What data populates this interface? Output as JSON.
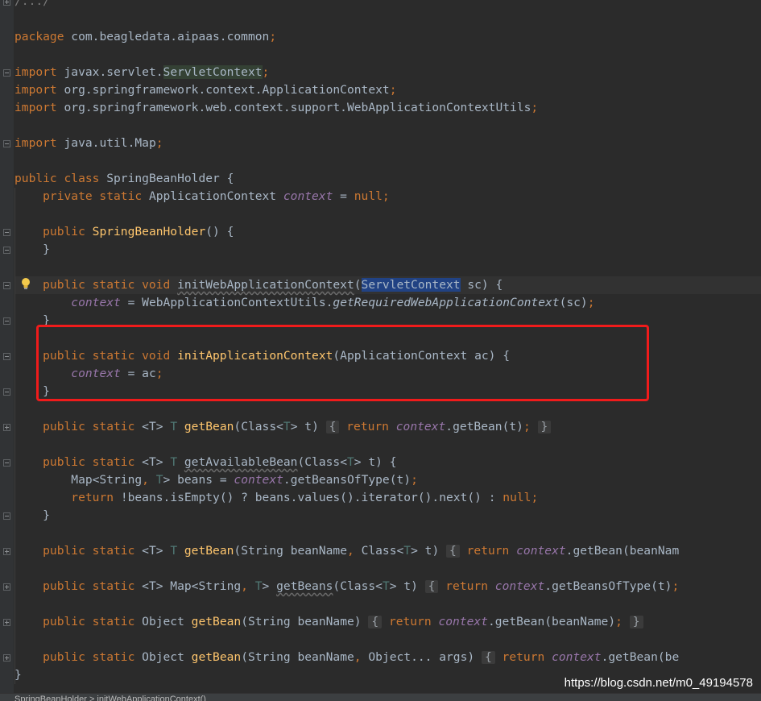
{
  "editor": {
    "lines": [
      {
        "id": "header-comment",
        "fold": "plus",
        "tokens": [
          [
            "/.../",
            "dim"
          ]
        ]
      },
      {
        "id": "blank-1",
        "tokens": []
      },
      {
        "id": "package",
        "tokens": [
          [
            "package ",
            "k"
          ],
          [
            "com.beagledata.aipaas.common",
            ""
          ],
          [
            ";",
            "k"
          ]
        ]
      },
      {
        "id": "blank-2",
        "tokens": []
      },
      {
        "id": "import-servlet",
        "fold": "minus",
        "tokens": [
          [
            "import ",
            "k"
          ],
          [
            "javax.servlet.",
            ""
          ],
          [
            "ServletContext",
            "hl-green"
          ],
          [
            ";",
            "k"
          ]
        ]
      },
      {
        "id": "import-appctx",
        "tokens": [
          [
            "import ",
            "k"
          ],
          [
            "org.springframework.context.ApplicationContext",
            ""
          ],
          [
            ";",
            "k"
          ]
        ]
      },
      {
        "id": "import-utils",
        "tokens": [
          [
            "import ",
            "k"
          ],
          [
            "org.springframework.web.context.support.WebApplicationContextUtils",
            ""
          ],
          [
            ";",
            "k"
          ]
        ]
      },
      {
        "id": "blank-3",
        "tokens": []
      },
      {
        "id": "import-map",
        "fold": "minus",
        "tokens": [
          [
            "import ",
            "k"
          ],
          [
            "java.util.Map",
            ""
          ],
          [
            ";",
            "k"
          ]
        ]
      },
      {
        "id": "blank-4",
        "tokens": []
      },
      {
        "id": "class-decl",
        "tokens": [
          [
            "public class ",
            "k"
          ],
          [
            "SpringBeanHolder {",
            ""
          ]
        ]
      },
      {
        "id": "field-context",
        "tokens": [
          [
            "    private static ",
            "k"
          ],
          [
            "ApplicationContext ",
            ""
          ],
          [
            "context",
            "f"
          ],
          [
            " = ",
            ""
          ],
          [
            "null",
            "k"
          ],
          [
            ";",
            "k"
          ]
        ]
      },
      {
        "id": "blank-5",
        "tokens": []
      },
      {
        "id": "constructor",
        "fold": "minus",
        "tokens": [
          [
            "    public ",
            "k"
          ],
          [
            "SpringBeanHolder",
            "m"
          ],
          [
            "() {",
            ""
          ]
        ]
      },
      {
        "id": "constructor-close",
        "fold": "minus",
        "tokens": [
          [
            "    }",
            ""
          ]
        ]
      },
      {
        "id": "blank-6",
        "tokens": []
      },
      {
        "id": "init-web",
        "fold": "minus",
        "caret": true,
        "tokens": [
          [
            "    public static void ",
            "k"
          ],
          [
            "initWebApplicationContext",
            "u"
          ],
          [
            "(",
            ""
          ],
          [
            "ServletContext",
            "hl-blue"
          ],
          [
            " sc) {",
            ""
          ]
        ]
      },
      {
        "id": "init-web-body",
        "tokens": [
          [
            "        ",
            ""
          ],
          [
            "context",
            "f"
          ],
          [
            " = WebApplicationContextUtils.",
            ""
          ],
          [
            "getRequiredWebApplicationContext",
            "i"
          ],
          [
            "(sc)",
            ""
          ],
          [
            ";",
            "k"
          ]
        ]
      },
      {
        "id": "init-web-close",
        "fold": "minus",
        "tokens": [
          [
            "    }",
            ""
          ]
        ]
      },
      {
        "id": "blank-7",
        "tokens": []
      },
      {
        "id": "init-app",
        "fold": "minus",
        "tokens": [
          [
            "    public static void ",
            "k"
          ],
          [
            "initApplicationContext",
            "m"
          ],
          [
            "(ApplicationContext ac) {",
            ""
          ]
        ]
      },
      {
        "id": "init-app-body",
        "tokens": [
          [
            "        ",
            ""
          ],
          [
            "context",
            "f"
          ],
          [
            " = ac",
            ""
          ],
          [
            ";",
            "k"
          ]
        ]
      },
      {
        "id": "init-app-close",
        "fold": "minus",
        "tokens": [
          [
            "    }",
            ""
          ]
        ]
      },
      {
        "id": "blank-8",
        "tokens": []
      },
      {
        "id": "get-bean-class",
        "fold": "plus",
        "tokens": [
          [
            "    public static ",
            "k"
          ],
          [
            "<T> ",
            ""
          ],
          [
            "T ",
            "g"
          ],
          [
            "getBean",
            "m"
          ],
          [
            "(Class<",
            ""
          ],
          [
            "T",
            "g"
          ],
          [
            "> t) ",
            ""
          ],
          [
            "{",
            "fold-box"
          ],
          [
            " ",
            ""
          ],
          [
            "return ",
            "k"
          ],
          [
            "context",
            "f"
          ],
          [
            ".getBean(t)",
            ""
          ],
          [
            ";",
            "k"
          ],
          [
            " ",
            ""
          ],
          [
            "}",
            "fold-box"
          ]
        ]
      },
      {
        "id": "blank-9",
        "tokens": []
      },
      {
        "id": "get-available",
        "fold": "minus",
        "tokens": [
          [
            "    public static ",
            "k"
          ],
          [
            "<T> ",
            ""
          ],
          [
            "T ",
            "g"
          ],
          [
            "getAvailableBean",
            "u"
          ],
          [
            "(Class<",
            ""
          ],
          [
            "T",
            "g"
          ],
          [
            "> t) {",
            ""
          ]
        ]
      },
      {
        "id": "get-available-map",
        "tokens": [
          [
            "        Map<String",
            ""
          ],
          [
            ", ",
            "k"
          ],
          [
            "T",
            "g"
          ],
          [
            "> beans = ",
            ""
          ],
          [
            "context",
            "f"
          ],
          [
            ".getBeansOfType(t)",
            ""
          ],
          [
            ";",
            "k"
          ]
        ]
      },
      {
        "id": "get-available-return",
        "tokens": [
          [
            "        ",
            ""
          ],
          [
            "return ",
            "k"
          ],
          [
            "!beans.isEmpty() ? beans.values().iterator().next() : ",
            ""
          ],
          [
            "null",
            "k"
          ],
          [
            ";",
            "k"
          ]
        ]
      },
      {
        "id": "get-available-close",
        "fold": "minus",
        "tokens": [
          [
            "    }",
            ""
          ]
        ]
      },
      {
        "id": "blank-10",
        "tokens": []
      },
      {
        "id": "get-bean-name-class",
        "fold": "plus",
        "tokens": [
          [
            "    public static ",
            "k"
          ],
          [
            "<T> ",
            ""
          ],
          [
            "T ",
            "g"
          ],
          [
            "getBean",
            "m"
          ],
          [
            "(String beanName",
            ""
          ],
          [
            ", ",
            "k"
          ],
          [
            "Class<",
            ""
          ],
          [
            "T",
            "g"
          ],
          [
            "> t) ",
            ""
          ],
          [
            "{",
            "fold-box"
          ],
          [
            " ",
            ""
          ],
          [
            "return ",
            "k"
          ],
          [
            "context",
            "f"
          ],
          [
            ".getBean(beanNam",
            ""
          ]
        ]
      },
      {
        "id": "blank-11",
        "tokens": []
      },
      {
        "id": "get-beans",
        "fold": "plus",
        "tokens": [
          [
            "    public static ",
            "k"
          ],
          [
            "<T> Map<String",
            ""
          ],
          [
            ", ",
            "k"
          ],
          [
            "T",
            "g"
          ],
          [
            "> ",
            ""
          ],
          [
            "getBeans",
            "u"
          ],
          [
            "(Class<",
            ""
          ],
          [
            "T",
            "g"
          ],
          [
            "> t) ",
            ""
          ],
          [
            "{",
            "fold-box"
          ],
          [
            " ",
            ""
          ],
          [
            "return ",
            "k"
          ],
          [
            "context",
            "f"
          ],
          [
            ".getBeansOfType(t)",
            ""
          ],
          [
            ";",
            "k"
          ]
        ]
      },
      {
        "id": "blank-12",
        "tokens": []
      },
      {
        "id": "get-bean-name",
        "fold": "plus",
        "tokens": [
          [
            "    public static ",
            "k"
          ],
          [
            "Object ",
            ""
          ],
          [
            "getBean",
            "m"
          ],
          [
            "(String beanName) ",
            ""
          ],
          [
            "{",
            "fold-box"
          ],
          [
            " ",
            ""
          ],
          [
            "return ",
            "k"
          ],
          [
            "context",
            "f"
          ],
          [
            ".getBean(beanName)",
            ""
          ],
          [
            ";",
            "k"
          ],
          [
            " ",
            ""
          ],
          [
            "}",
            "fold-box"
          ]
        ]
      },
      {
        "id": "blank-13",
        "tokens": []
      },
      {
        "id": "get-bean-args",
        "fold": "plus",
        "tokens": [
          [
            "    public static ",
            "k"
          ],
          [
            "Object ",
            ""
          ],
          [
            "getBean",
            "m"
          ],
          [
            "(String beanName",
            ""
          ],
          [
            ", ",
            "k"
          ],
          [
            "Object... args) ",
            ""
          ],
          [
            "{",
            "fold-box"
          ],
          [
            " ",
            ""
          ],
          [
            "return ",
            "k"
          ],
          [
            "context",
            "f"
          ],
          [
            ".getBean(be",
            ""
          ]
        ]
      },
      {
        "id": "class-close",
        "tokens": [
          [
            "}",
            ""
          ]
        ]
      }
    ]
  },
  "status": {
    "breadcrumb": "SpringBeanHolder > initWebApplicationContext()"
  },
  "watermark": {
    "text": "https://blog.csdn.net/m0_49194578"
  },
  "annotation": {
    "color": "#f01b1b"
  }
}
